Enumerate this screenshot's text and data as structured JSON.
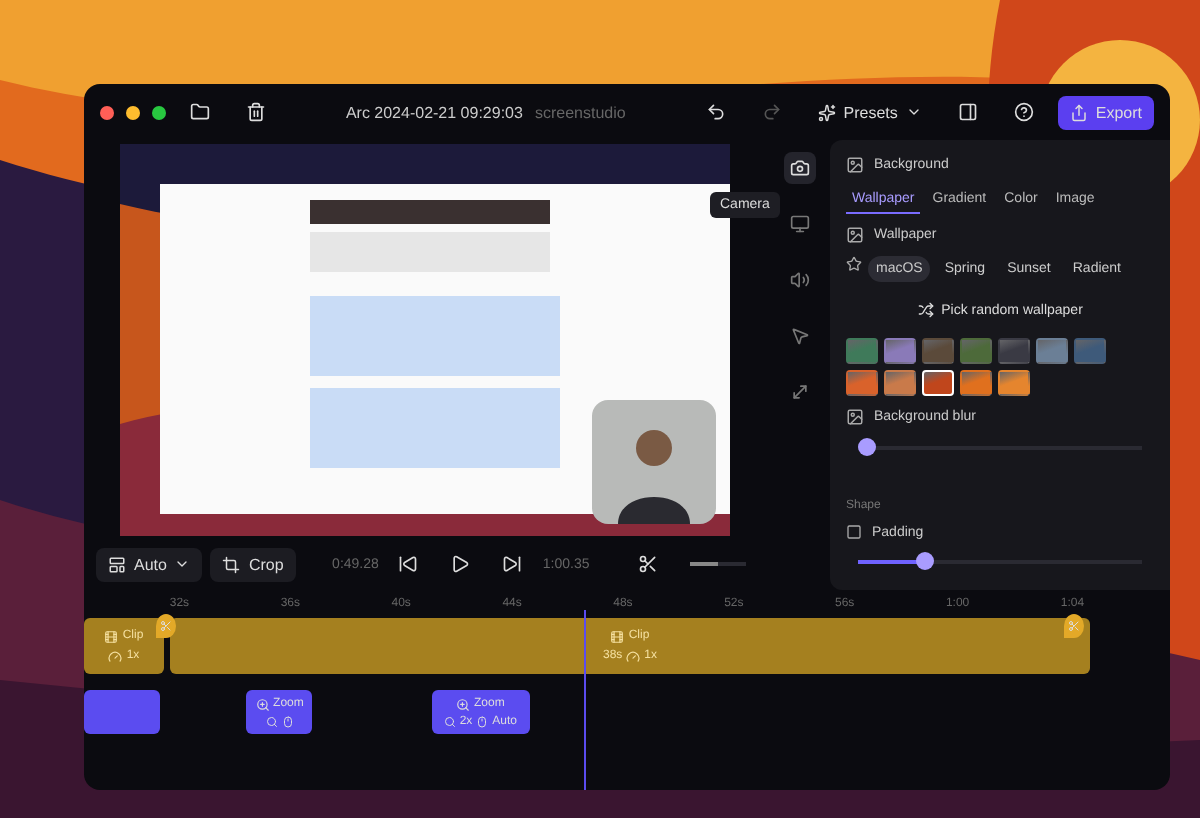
{
  "window": {
    "title": "Arc 2024-02-21 09:29:03",
    "subtitle": "screenstudio"
  },
  "toolbar": {
    "presets": "Presets",
    "export": "Export"
  },
  "preview": {
    "kind": "picture"
  },
  "tools": {
    "tooltip": "Camera",
    "items": [
      {
        "kind": "camera",
        "selected": true
      },
      {
        "kind": "screen",
        "selected": false
      },
      {
        "kind": "audio",
        "selected": false
      },
      {
        "kind": "cursor",
        "selected": false
      },
      {
        "kind": "resize",
        "selected": false
      }
    ]
  },
  "panel": {
    "background": {
      "heading": "Background",
      "tabs": [
        {
          "label": "Wallpaper",
          "selected": true
        },
        {
          "label": "Gradient",
          "selected": false
        },
        {
          "label": "Color",
          "selected": false
        },
        {
          "label": "Image",
          "selected": false
        }
      ]
    },
    "wallpaper": {
      "heading": "Wallpaper",
      "categories": [
        {
          "label": "macOS",
          "selected": true
        },
        {
          "label": "Spring",
          "selected": false
        },
        {
          "label": "Sunset",
          "selected": false
        },
        {
          "label": "Radient",
          "selected": false
        }
      ],
      "random": "Pick random wallpaper",
      "thumbnails": [
        {
          "color": "#3f7a5a",
          "selected": false
        },
        {
          "color": "#8a7ab8",
          "selected": false
        },
        {
          "color": "#5b4a3a",
          "selected": false
        },
        {
          "color": "#4d6a3a",
          "selected": false
        },
        {
          "color": "#3a3a44",
          "selected": false
        },
        {
          "color": "#6b7f96",
          "selected": false
        },
        {
          "color": "#3e5a7a",
          "selected": false
        },
        {
          "color": "#d9622b",
          "selected": false
        },
        {
          "color": "#c97a4a",
          "selected": false
        },
        {
          "color": "#c0461c",
          "selected": true
        },
        {
          "color": "#e0701e",
          "selected": false
        },
        {
          "color": "#e5852e",
          "selected": false
        }
      ]
    },
    "blur": {
      "heading": "Background blur",
      "level": 0
    },
    "shape": {
      "heading": "Shape",
      "padding": "Padding",
      "level": 0.22
    }
  },
  "controls": {
    "layout": "Auto",
    "crop": "Crop",
    "time_start": "0:49.28",
    "time_end": "1:00.35",
    "zoom_slider": {
      "level": 0.5
    }
  },
  "timeline": {
    "ticks": [
      "32s",
      "36s",
      "40s",
      "44s",
      "48s",
      "52s",
      "56s",
      "1:00",
      "1:04"
    ],
    "clips": [
      {
        "label": "Clip",
        "speed": "1x"
      },
      {
        "label": "Clip",
        "duration": "38s",
        "speed": "1x"
      }
    ],
    "zooms": [
      {
        "kind": "plain"
      },
      {
        "kind": "zoom",
        "label": "Zoom"
      },
      {
        "kind": "zoom",
        "label": "Zoom",
        "scale": "2x",
        "mode": "Auto"
      }
    ]
  }
}
